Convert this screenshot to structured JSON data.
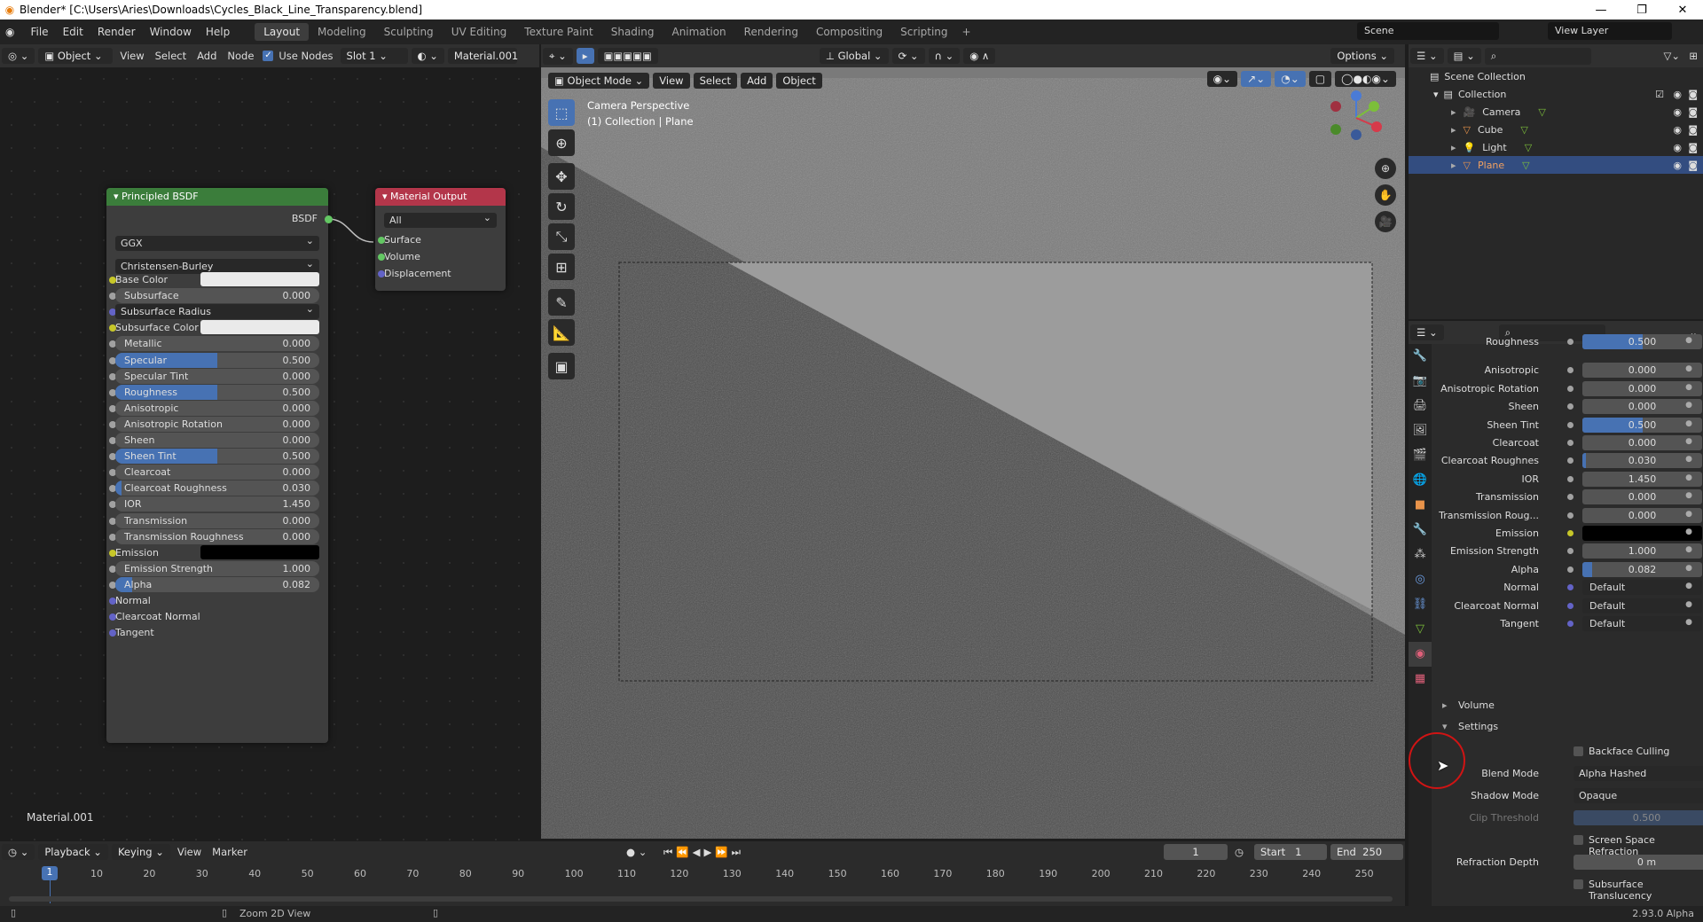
{
  "window": {
    "title": "Blender* [C:\\Users\\Aries\\Downloads\\Cycles_Black_Line_Transparency.blend]"
  },
  "menu": [
    "File",
    "Edit",
    "Render",
    "Window",
    "Help"
  ],
  "workspaces": [
    "Layout",
    "Modeling",
    "Sculpting",
    "UV Editing",
    "Texture Paint",
    "Shading",
    "Animation",
    "Rendering",
    "Compositing",
    "Scripting"
  ],
  "scene": "Scene",
  "view_layer": "View Layer",
  "node_header": {
    "mode": "Object",
    "view": "View",
    "select": "Select",
    "add": "Add",
    "node": "Node",
    "use_nodes": "Use Nodes",
    "slot": "Slot 1",
    "material": "Material.001"
  },
  "viewport_header": {
    "transform": "Global",
    "options": "Options",
    "mode": "Object Mode",
    "view": "View",
    "select": "Select",
    "add": "Add",
    "object": "Object"
  },
  "viewport": {
    "line1": "Camera Perspective",
    "line2": "(1) Collection | Plane"
  },
  "bsdf": {
    "title": "Principled BSDF",
    "out": "BSDF",
    "distribution": "GGX",
    "subsurface_method": "Christensen-Burley",
    "rows": [
      {
        "label": "Base Color",
        "kind": "color",
        "sock": "y"
      },
      {
        "label": "Subsurface",
        "value": "0.000",
        "fill": 0
      },
      {
        "label": "Subsurface Radius",
        "kind": "dd",
        "sock": "b"
      },
      {
        "label": "Subsurface Color",
        "kind": "color",
        "sock": "y"
      },
      {
        "label": "Metallic",
        "value": "0.000",
        "fill": 0
      },
      {
        "label": "Specular",
        "value": "0.500",
        "fill": 0.5
      },
      {
        "label": "Specular Tint",
        "value": "0.000",
        "fill": 0
      },
      {
        "label": "Roughness",
        "value": "0.500",
        "fill": 0.5
      },
      {
        "label": "Anisotropic",
        "value": "0.000",
        "fill": 0
      },
      {
        "label": "Anisotropic Rotation",
        "value": "0.000",
        "fill": 0
      },
      {
        "label": "Sheen",
        "value": "0.000",
        "fill": 0
      },
      {
        "label": "Sheen Tint",
        "value": "0.500",
        "fill": 0.5
      },
      {
        "label": "Clearcoat",
        "value": "0.000",
        "fill": 0
      },
      {
        "label": "Clearcoat Roughness",
        "value": "0.030",
        "fill": 0.03
      },
      {
        "label": "IOR",
        "value": "1.450",
        "fill": 0
      },
      {
        "label": "Transmission",
        "value": "0.000",
        "fill": 0
      },
      {
        "label": "Transmission Roughness",
        "value": "0.000",
        "fill": 0
      },
      {
        "label": "Emission",
        "kind": "black",
        "sock": "y"
      },
      {
        "label": "Emission Strength",
        "value": "1.000",
        "fill": 0
      },
      {
        "label": "Alpha",
        "value": "0.082",
        "fill": 0.082
      },
      {
        "label": "Normal",
        "kind": "plain",
        "sock": "b"
      },
      {
        "label": "Clearcoat Normal",
        "kind": "plain",
        "sock": "b"
      },
      {
        "label": "Tangent",
        "kind": "plain",
        "sock": "b"
      }
    ]
  },
  "matout": {
    "title": "Material Output",
    "target": "All",
    "inputs": [
      "Surface",
      "Volume",
      "Displacement"
    ]
  },
  "node_material_label": "Material.001",
  "outliner": {
    "root": "Scene Collection",
    "collection": "Collection",
    "items": [
      "Camera",
      "Cube",
      "Light",
      "Plane"
    ]
  },
  "props": {
    "rows": [
      {
        "label": "Roughness",
        "value": "0.500",
        "fill": 0.5
      },
      {
        "label": "Anisotropic",
        "value": "0.000",
        "fill": 0
      },
      {
        "label": "Anisotropic Rotation",
        "value": "0.000",
        "fill": 0
      },
      {
        "label": "Sheen",
        "value": "0.000",
        "fill": 0
      },
      {
        "label": "Sheen Tint",
        "value": "0.500",
        "fill": 0.5
      },
      {
        "label": "Clearcoat",
        "value": "0.000",
        "fill": 0
      },
      {
        "label": "Clearcoat Roughnes",
        "value": "0.030",
        "fill": 0.03
      },
      {
        "label": "IOR",
        "value": "1.450",
        "fill": 0
      },
      {
        "label": "Transmission",
        "value": "0.000",
        "fill": 0
      },
      {
        "label": "Transmission Roug...",
        "value": "0.000",
        "fill": 0
      },
      {
        "label": "Emission",
        "value": "",
        "fill": 0,
        "black": true
      },
      {
        "label": "Emission Strength",
        "value": "1.000",
        "fill": 0
      },
      {
        "label": "Alpha",
        "value": "0.082",
        "fill": 0.082
      },
      {
        "label": "Normal",
        "value": "Default",
        "link": true
      },
      {
        "label": "Clearcoat Normal",
        "value": "Default",
        "link": true
      },
      {
        "label": "Tangent",
        "value": "Default",
        "link": true
      }
    ],
    "volume": "Volume",
    "settings": "Settings",
    "backface": "Backface Culling",
    "blend_mode_label": "Blend Mode",
    "blend_mode": "Alpha Hashed",
    "shadow_mode_label": "Shadow Mode",
    "shadow_mode": "Opaque",
    "clip_label": "Clip Threshold",
    "clip": "0.500",
    "ssr": "Screen Space Refraction",
    "refr_label": "Refraction Depth",
    "refr": "0 m",
    "sst": "Subsurface Translucency"
  },
  "timeline": {
    "playback": "Playback",
    "keying": "Keying",
    "view": "View",
    "marker": "Marker",
    "frame": "1",
    "start_label": "Start",
    "start": "1",
    "end_label": "End",
    "end": "250",
    "ticks": [
      "10",
      "20",
      "30",
      "40",
      "50",
      "60",
      "70",
      "80",
      "90",
      "100",
      "110",
      "120",
      "130",
      "140",
      "150",
      "160",
      "170",
      "180",
      "190",
      "200",
      "210",
      "220",
      "230",
      "240",
      "250"
    ],
    "current": "1"
  },
  "status": {
    "hint": "Zoom 2D View",
    "version": "2.93.0 Alpha"
  }
}
